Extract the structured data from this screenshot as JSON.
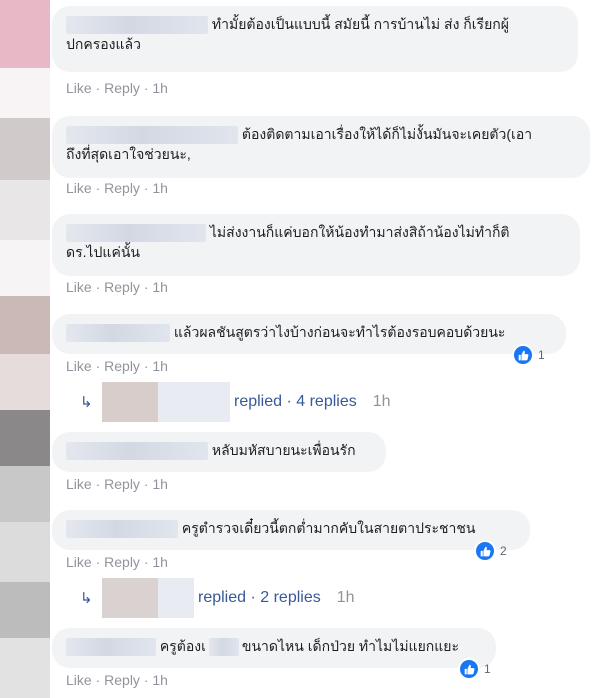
{
  "colors": {
    "bubble": "#f2f3f5",
    "link": "#385898",
    "meta": "#90949c",
    "like": "#1877f2"
  },
  "actions": {
    "like": "Like",
    "reply": "Reply",
    "separator": "·"
  },
  "comments": [
    {
      "line1": "ทำมั้ยต้องเป็นแบบนี้ สมัยนี้ การบ้านไม่ ส่ง ก็เรียกผู้",
      "line2": "ปกครองแล้ว",
      "time": "1h"
    },
    {
      "line1": "ต้องติดตามเอาเรื่องให้ได้ก็ไม่งั้นมันจะเคยตัว(เอา",
      "line2": "ถึงที่สุดเอาใจช่วยนะ,",
      "time": "1h"
    },
    {
      "line1": "ไม่ส่งงานก็แค่บอกให้น้องทำมาส่งสิถ้าน้องไม่ทำก็ติ",
      "line2": "ดร.ไปแค่นั้น",
      "time": "1h"
    },
    {
      "line1": "แล้วผลชันสูตรว่าไงบ้างก่อนจะทำไรต้องรอบคอบด้วยนะ",
      "time": "1h",
      "reactions": "1",
      "reply_summary": {
        "text": "replied · 4 replies",
        "time": "1h"
      }
    },
    {
      "line1": "หลับมหัสบายนะเพื่อนรัก",
      "time": "1h"
    },
    {
      "line1": "ครูตำรวจเดี๋ยวนี้ตกต่ำมากคับในสายตาประชาชน",
      "time": "1h",
      "reactions": "2",
      "reply_summary": {
        "text": "replied · 2 replies",
        "time": "1h"
      }
    },
    {
      "line1a": "ครูต้องเ",
      "line1b": "ขนาดไหน เด็กป่วย ทำไมไม่แยกแยะ",
      "time": "1h",
      "reactions": "1"
    }
  ]
}
